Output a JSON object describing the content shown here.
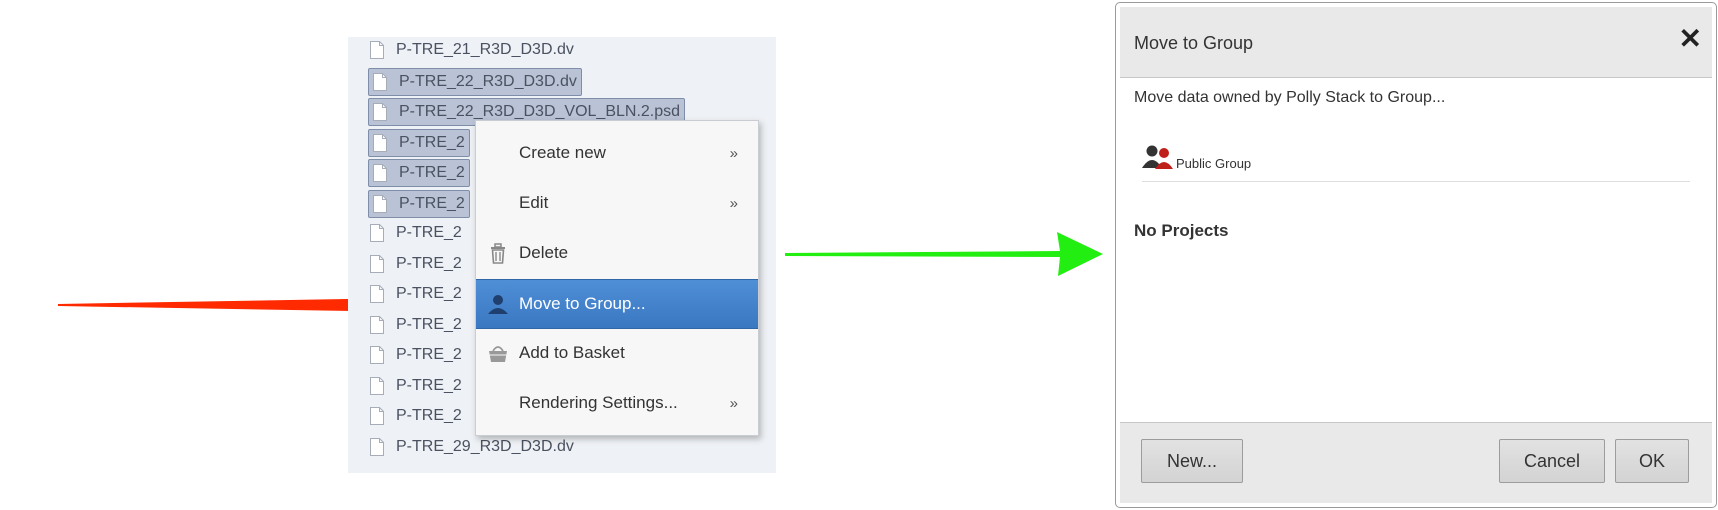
{
  "file_tree": {
    "files": [
      {
        "name": "P-TRE_21_R3D_D3D.dv",
        "selected": false
      },
      {
        "name": "P-TRE_22_R3D_D3D.dv",
        "selected": true
      },
      {
        "name": "P-TRE_22_R3D_D3D_VOL_BLN.2.psd",
        "selected": true
      },
      {
        "name": "P-TRE_2",
        "selected": true
      },
      {
        "name": "P-TRE_2",
        "selected": true
      },
      {
        "name": "P-TRE_2",
        "selected": true
      },
      {
        "name": "P-TRE_2",
        "selected": false
      },
      {
        "name": "P-TRE_2",
        "selected": false
      },
      {
        "name": "P-TRE_2",
        "selected": false
      },
      {
        "name": "P-TRE_2",
        "selected": false
      },
      {
        "name": "P-TRE_2",
        "selected": false
      },
      {
        "name": "P-TRE_2",
        "selected": false
      },
      {
        "name": "P-TRE_2",
        "selected": false
      },
      {
        "name": "P-TRE_29_R3D_D3D.dv",
        "selected": false
      }
    ]
  },
  "context_menu": {
    "items": [
      {
        "label": "Create new",
        "icon": "none",
        "submenu_arrow": "»"
      },
      {
        "label": "Edit",
        "icon": "none",
        "submenu_arrow": "»"
      },
      {
        "label": "Delete",
        "icon": "trash-icon",
        "submenu_arrow": ""
      },
      {
        "label": "Move to Group...",
        "icon": "user-icon",
        "submenu_arrow": "",
        "active": true
      },
      {
        "label": "Add to Basket",
        "icon": "basket-icon",
        "submenu_arrow": ""
      },
      {
        "label": "Rendering Settings...",
        "icon": "none",
        "submenu_arrow": "»"
      }
    ]
  },
  "dialog": {
    "title": "Move to Group",
    "close_symbol": "✕",
    "intro": "Move data owned by Polly Stack to Group...",
    "group": {
      "label": "Public Group",
      "icon": "group-icon"
    },
    "no_projects": "No Projects",
    "buttons": {
      "new": "New...",
      "cancel": "Cancel",
      "ok": "OK"
    }
  },
  "colors": {
    "red_arrow": "#ff2a00",
    "green_arrow": "#22ee11",
    "menu_active": "#3a78c2",
    "selected_row": "#b9c3d5"
  }
}
